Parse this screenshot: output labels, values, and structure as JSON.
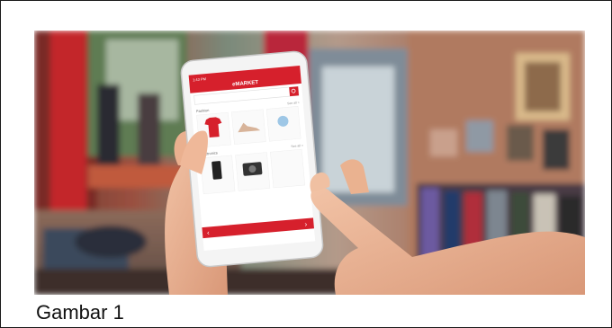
{
  "figure": {
    "caption": "Gambar 1"
  },
  "phone_screen": {
    "app_title": "eMARKET",
    "status_time": "1:43 PM",
    "section_fashion": "Fashion",
    "section_electronics": "Electronics",
    "see_all_1": "See all >",
    "see_all_2": "See all >",
    "accent_color": "#d6202c"
  }
}
